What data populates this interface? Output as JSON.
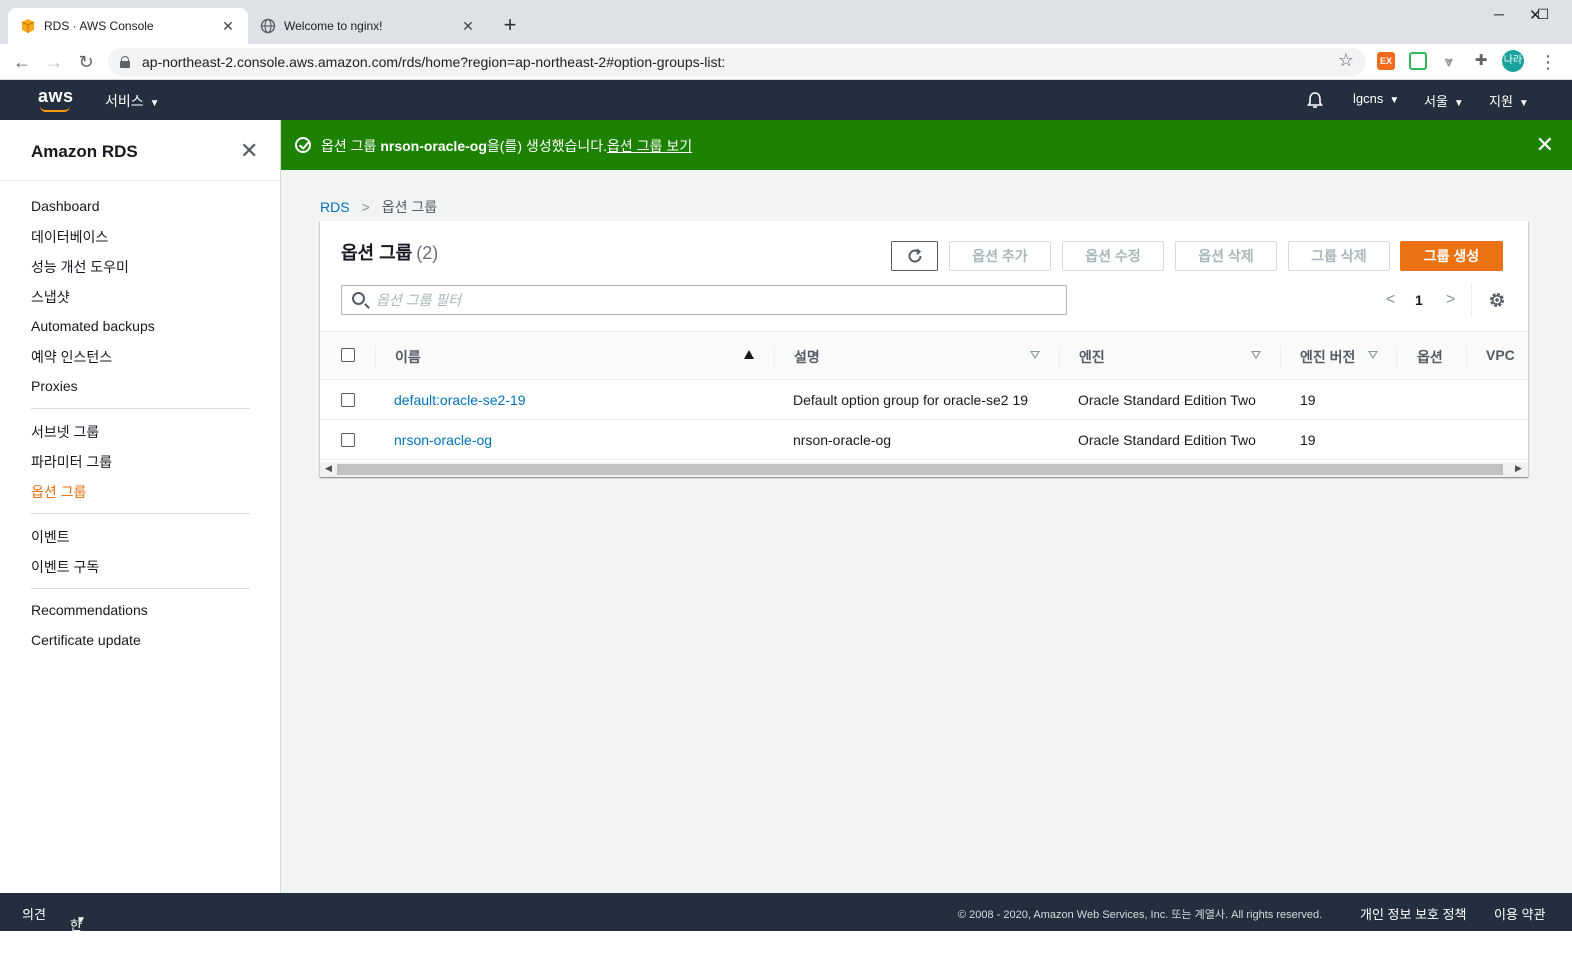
{
  "browser": {
    "tabs": [
      {
        "title": "RDS · AWS Console"
      },
      {
        "title": "Welcome to nginx!"
      }
    ],
    "new_tab": "+",
    "url": "ap-northeast-2.console.aws.amazon.com/rds/home?region=ap-northeast-2#option-groups-list:",
    "profile": "나라",
    "ext_label": "EX"
  },
  "aws_nav": {
    "logo": "aws",
    "services": "서비스",
    "account": "lgcns",
    "region": "서울",
    "support": "지원"
  },
  "sidebar": {
    "title": "Amazon RDS",
    "items": [
      {
        "label": "Dashboard"
      },
      {
        "label": "데이터베이스"
      },
      {
        "label": "성능 개선 도우미"
      },
      {
        "label": "스냅샷"
      },
      {
        "label": "Automated backups"
      },
      {
        "label": "예약 인스턴스"
      },
      {
        "label": "Proxies"
      },
      {
        "label": "서브넷 그룹"
      },
      {
        "label": "파라미터 그룹"
      },
      {
        "label": "옵션 그룹"
      },
      {
        "label": "이벤트"
      },
      {
        "label": "이벤트 구독"
      },
      {
        "label": "Recommendations"
      },
      {
        "label": "Certificate update"
      }
    ]
  },
  "flash": {
    "prefix": "옵션 그룹 ",
    "name": "nrson-oracle-og",
    "suffix": "을(를) 생성했습니다.",
    "link": "옵션 그룹 보기"
  },
  "breadcrumb": {
    "root": "RDS",
    "current": "옵션 그룹"
  },
  "panel": {
    "title": "옵션 그룹",
    "count": "(2)",
    "buttons": {
      "add_option": "옵션 추가",
      "modify_option": "옵션 수정",
      "delete_option": "옵션 삭제",
      "delete_group": "그룹 삭제",
      "create_group": "그룹 생성"
    },
    "search_placeholder": "옵션 그룹 필터",
    "page": "1"
  },
  "table": {
    "columns": [
      "이름",
      "설명",
      "엔진",
      "엔진 버전",
      "옵션",
      "VPC"
    ],
    "rows": [
      {
        "name": "default:oracle-se2-19",
        "description": "Default option group for oracle-se2 19",
        "engine": "Oracle Standard Edition Two",
        "version": "19"
      },
      {
        "name": "nrson-oracle-og",
        "description": "nrson-oracle-og",
        "engine": "Oracle Standard Edition Two",
        "version": "19"
      }
    ]
  },
  "footer": {
    "feedback": "의견",
    "language": "한국어",
    "copyright": "© 2008 - 2020, Amazon Web Services, Inc. 또는 계열사. All rights reserved.",
    "privacy": "개인 정보 보호 정책",
    "terms": "이용 약관"
  },
  "colors": {
    "aws_nav": "#232f3e",
    "success": "#1d8102",
    "primary": "#ec7211",
    "link": "#0073bb"
  }
}
